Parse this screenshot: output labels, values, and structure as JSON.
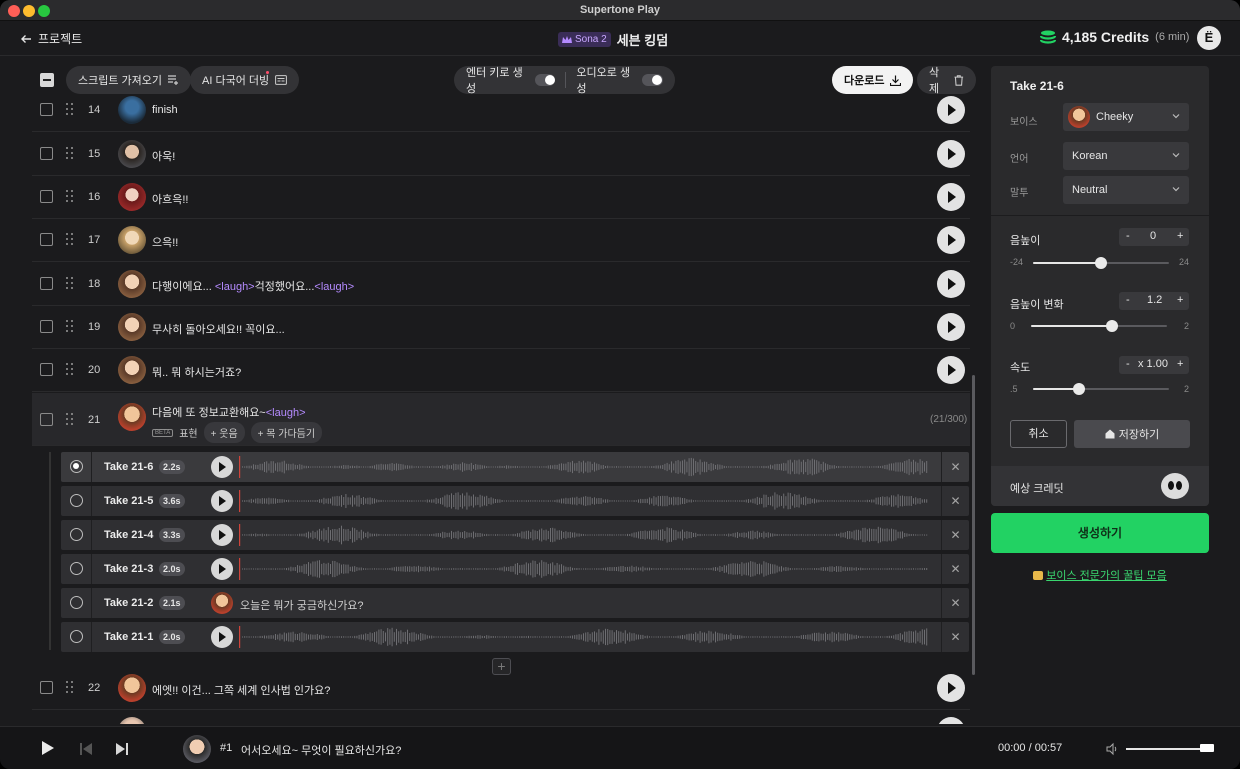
{
  "window": {
    "title": "Supertone Play"
  },
  "header": {
    "back_label": "프로젝트",
    "model_badge": "Sona 2",
    "project_name": "세븐 킹덤",
    "credits_amount": "4,185 Credits",
    "credits_minutes": "(6 min)",
    "user_initial": "Ë"
  },
  "toolbar": {
    "import_script": "스크립트 가져오기",
    "ai_dubbing": "AI 다국어 더빙",
    "enter_generate": "엔터 키로 생성",
    "audio_generate": "오디오로 생성",
    "download": "다운로드",
    "delete": "삭제"
  },
  "rows": [
    {
      "num": "14",
      "text": "finish",
      "tag": "",
      "tail": ""
    },
    {
      "num": "15",
      "text": "아욱!",
      "tag": "",
      "tail": ""
    },
    {
      "num": "16",
      "text": "아흐윽!!",
      "tag": "",
      "tail": ""
    },
    {
      "num": "17",
      "text": "으윽!!",
      "tag": "",
      "tail": ""
    },
    {
      "num": "18",
      "text": "다행이에요...",
      "tag": "<laugh>",
      "tail": "걱정했어요...",
      "tag2": "<laugh>"
    },
    {
      "num": "19",
      "text": "무사히 돌아오세요!! 꼭이요...",
      "tag": "",
      "tail": ""
    },
    {
      "num": "20",
      "text": "뭐.. 뭐 하시는거죠?",
      "tag": "",
      "tail": ""
    }
  ],
  "active_row": {
    "num": "21",
    "text": "다음에 또 정보교환해요~",
    "tag": "<laugh>",
    "beta": "BETA",
    "expression": "표현",
    "chip_laugh": "+ 웃음",
    "chip_throat": "+ 목 가다듬기",
    "count": "(21/300)"
  },
  "takes": [
    {
      "name": "Take 21-6",
      "duration": "2.2s",
      "selected": true
    },
    {
      "name": "Take 21-5",
      "duration": "3.6s",
      "selected": false
    },
    {
      "name": "Take 21-4",
      "duration": "3.3s",
      "selected": false
    },
    {
      "name": "Take 21-3",
      "duration": "2.0s",
      "selected": false
    },
    {
      "name": "Take 21-2",
      "duration": "2.1s",
      "selected": false,
      "text": "오늘은 뭐가 궁금하신가요?"
    },
    {
      "name": "Take 21-1",
      "duration": "2.0s",
      "selected": false
    }
  ],
  "row22": {
    "num": "22",
    "text": "에엣!! 이건... 그쪽 세계 인사법 인가요?"
  },
  "panel": {
    "title": "Take 21-6",
    "voice_label": "보이스",
    "voice_value": "Cheeky",
    "language_label": "언어",
    "language_value": "Korean",
    "style_label": "말투",
    "style_value": "Neutral",
    "pitch_label": "음높이",
    "pitch_value": "0",
    "pitch_min": "-24",
    "pitch_max": "24",
    "pitch_var_label": "음높이 변화",
    "pitch_var_value": "1.2",
    "pitch_var_min": "0",
    "pitch_var_max": "2",
    "speed_label": "속도",
    "speed_value": "x 1.00",
    "speed_min": ".5",
    "speed_max": "2",
    "cancel": "취소",
    "save": "저장하기",
    "est_credit": "예상 크레딧"
  },
  "generate_label": "생성하기",
  "tips_label": "보이스 전문가의 꿀팁 모음",
  "player": {
    "track_num": "#1",
    "track_text": "어서오세요~ 무엇이 필요하신가요?",
    "time": "00:00 / 00:57"
  },
  "colors": {
    "accent_green": "#22d263",
    "tag_purple": "#b58bff",
    "badge_purple": "#3a2d57"
  }
}
